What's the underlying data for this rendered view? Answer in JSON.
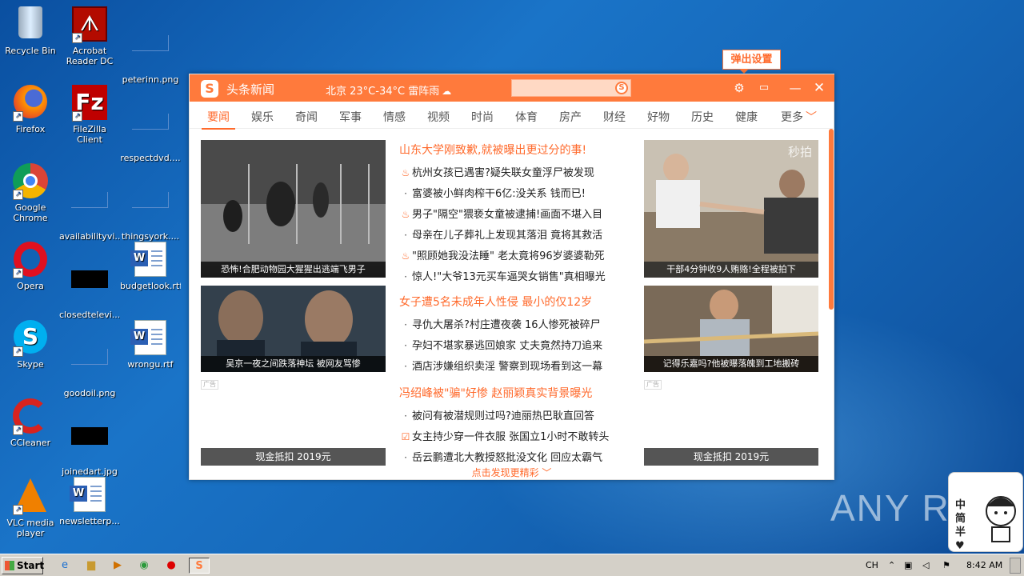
{
  "desktop": {
    "icons": [
      {
        "label": "Recycle Bin",
        "icon": "recycle-bin-icon"
      },
      {
        "label": "Acrobat Reader DC",
        "icon": "acrobat-icon"
      },
      {
        "label": "peterinn.png",
        "icon": "png-file-icon"
      },
      {
        "label": "Firefox",
        "icon": "firefox-icon"
      },
      {
        "label": "FileZilla Client",
        "icon": "filezilla-icon"
      },
      {
        "label": "respectdvd....",
        "icon": "file-icon"
      },
      {
        "label": "Google Chrome",
        "icon": "chrome-icon"
      },
      {
        "label": "availabilityvi...",
        "icon": "file-icon"
      },
      {
        "label": "thingsyork....",
        "icon": "file-icon"
      },
      {
        "label": "Opera",
        "icon": "opera-icon"
      },
      {
        "label": "closedtelevi...",
        "icon": "file-icon"
      },
      {
        "label": "budgetlook.rtf",
        "icon": "word-doc-icon"
      },
      {
        "label": "Skype",
        "icon": "skype-icon"
      },
      {
        "label": "goodoil.png",
        "icon": "png-file-icon"
      },
      {
        "label": "wrongu.rtf",
        "icon": "word-doc-icon"
      },
      {
        "label": "CCleaner",
        "icon": "ccleaner-icon"
      },
      {
        "label": "joinedart.jpg",
        "icon": "jpg-file-icon"
      },
      {
        "label": "VLC media player",
        "icon": "vlc-icon"
      },
      {
        "label": "newsletterp...",
        "icon": "word-doc-icon"
      }
    ]
  },
  "popup_tooltip": "弹出设置",
  "window": {
    "logo": "S",
    "title": "头条新闻",
    "weather": "北京 23°C-34°C 雷阵雨",
    "search_placeholder": "",
    "search_logo": "S",
    "tabs": [
      "要闻",
      "娱乐",
      "奇闻",
      "军事",
      "情感",
      "视频",
      "时尚",
      "体育",
      "房产",
      "财经",
      "好物",
      "历史",
      "健康",
      "更多"
    ],
    "active_tab": "要闻",
    "left_column": {
      "pic1_caption": "恐怖!合肥动物园大猩猩出逃端飞男子",
      "pic2_caption": "吴京一夜之间跌落神坛 被网友骂惨",
      "ad_badge": "广告",
      "promo": "现金抵扣 2019元"
    },
    "right_column": {
      "pic1_caption": "干部4分钟收9人贿赂!全程被拍下",
      "pic1_watermark": "秒拍",
      "pic2_caption": "记得乐嘉吗?他被曝落魄到工地搬砖",
      "ad_badge": "广告",
      "promo": "现金抵扣 2019元"
    },
    "news": [
      {
        "type": "headline",
        "text": "山东大学刚致歉,就被曝出更过分的事!"
      },
      {
        "type": "hot",
        "text": "杭州女孩已遇害?疑失联女童浮尸被发现"
      },
      {
        "type": "dot",
        "text": "富婆被小鲜肉榨干6亿:没关系 钱而已!"
      },
      {
        "type": "hot",
        "text": "男子\"隔空\"猥亵女童被逮捕!画面不堪入目"
      },
      {
        "type": "dot",
        "text": "母亲在儿子葬礼上发现其落泪 竟将其救活"
      },
      {
        "type": "hot",
        "text": "\"照顾她我没法睡\" 老太竟将96岁婆婆勒死"
      },
      {
        "type": "dot",
        "text": "惊人!\"大爷13元买车逼哭女销售\"真相曝光"
      },
      {
        "type": "headline",
        "text": "女子遭5名未成年人性侵 最小的仅12岁"
      },
      {
        "type": "dot",
        "text": "寻仇大屠杀?村庄遭夜袭 16人惨死被碎尸"
      },
      {
        "type": "dot",
        "text": "孕妇不堪家暴逃回娘家 丈夫竟然持刀追来"
      },
      {
        "type": "dot",
        "text": "酒店涉嫌组织卖淫 警察到现场看到这一幕"
      },
      {
        "type": "headline",
        "text": "冯绍峰被\"骗\"好惨 赵丽颖真实背景曝光"
      },
      {
        "type": "dot",
        "text": "被问有被潜规则过吗?迪丽热巴耿直回答"
      },
      {
        "type": "box",
        "text": "女主持少穿一件衣服 张国立1小时不敢转头"
      },
      {
        "type": "dot",
        "text": "岳云鹏遭北大教授怒批没文化 回应太霸气"
      }
    ],
    "more_link": "点击发现更精彩"
  },
  "taskbar": {
    "start": "Start",
    "language": "CH",
    "time": "8:42 AM"
  },
  "watermark": "ANY RUN",
  "sticker": {
    "text": [
      "中",
      "简",
      "半"
    ]
  }
}
